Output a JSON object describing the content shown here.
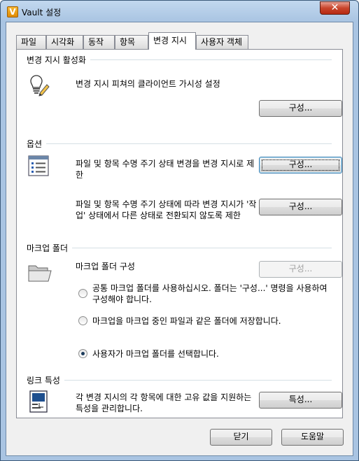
{
  "window": {
    "title": "Vault 설정",
    "close_glyph": "✕"
  },
  "tabs": [
    {
      "label": "파일"
    },
    {
      "label": "시각화"
    },
    {
      "label": "동작"
    },
    {
      "label": "항목"
    },
    {
      "label": "변경 지시",
      "active": true
    },
    {
      "label": "사용자 객체"
    }
  ],
  "sections": {
    "eco_visibility": {
      "heading": "변경 지시 활성화",
      "description": "변경 지시 피쳐의 클라이언트 가시성 설정",
      "button": "구성..."
    },
    "options": {
      "heading": "옵션",
      "item1_description": "파일 및 항목 수명 주기 상태 변경을 변경 지시로 제한",
      "item1_button": "구성...",
      "item2_description": "파일 및 항목 수명 주기 상태에 따라 변경 지시가 '작업' 상태에서 다른 상태로 전환되지 않도록 제한",
      "item2_button": "구성..."
    },
    "markup_folder": {
      "heading": "마크업 폴더",
      "description": "마크업 폴더 구성",
      "button": "구성...",
      "radio_shared": "공통 마크업 폴더를 사용하십시오. 폴더는 '구성...' 명령을 사용하여 구성해야 합니다.",
      "radio_same": "마크업을 마크업 중인 파일과 같은 폴더에 저장합니다.",
      "radio_user": "사용자가 마크업 폴더를 선택합니다.",
      "selected": "radio_user"
    },
    "link_properties": {
      "heading": "링크 특성",
      "description": "각 변경 지시의 각 항목에 대한 고유 값을 지원하는 특성을 관리합니다.",
      "button": "특성..."
    }
  },
  "footer": {
    "close_button": "닫기",
    "help_button": "도움말"
  },
  "icons": {
    "visibility": "lightbulb-pencil-icon",
    "options": "list-form-icon",
    "markup": "open-folder-icon",
    "link": "link-properties-icon"
  }
}
